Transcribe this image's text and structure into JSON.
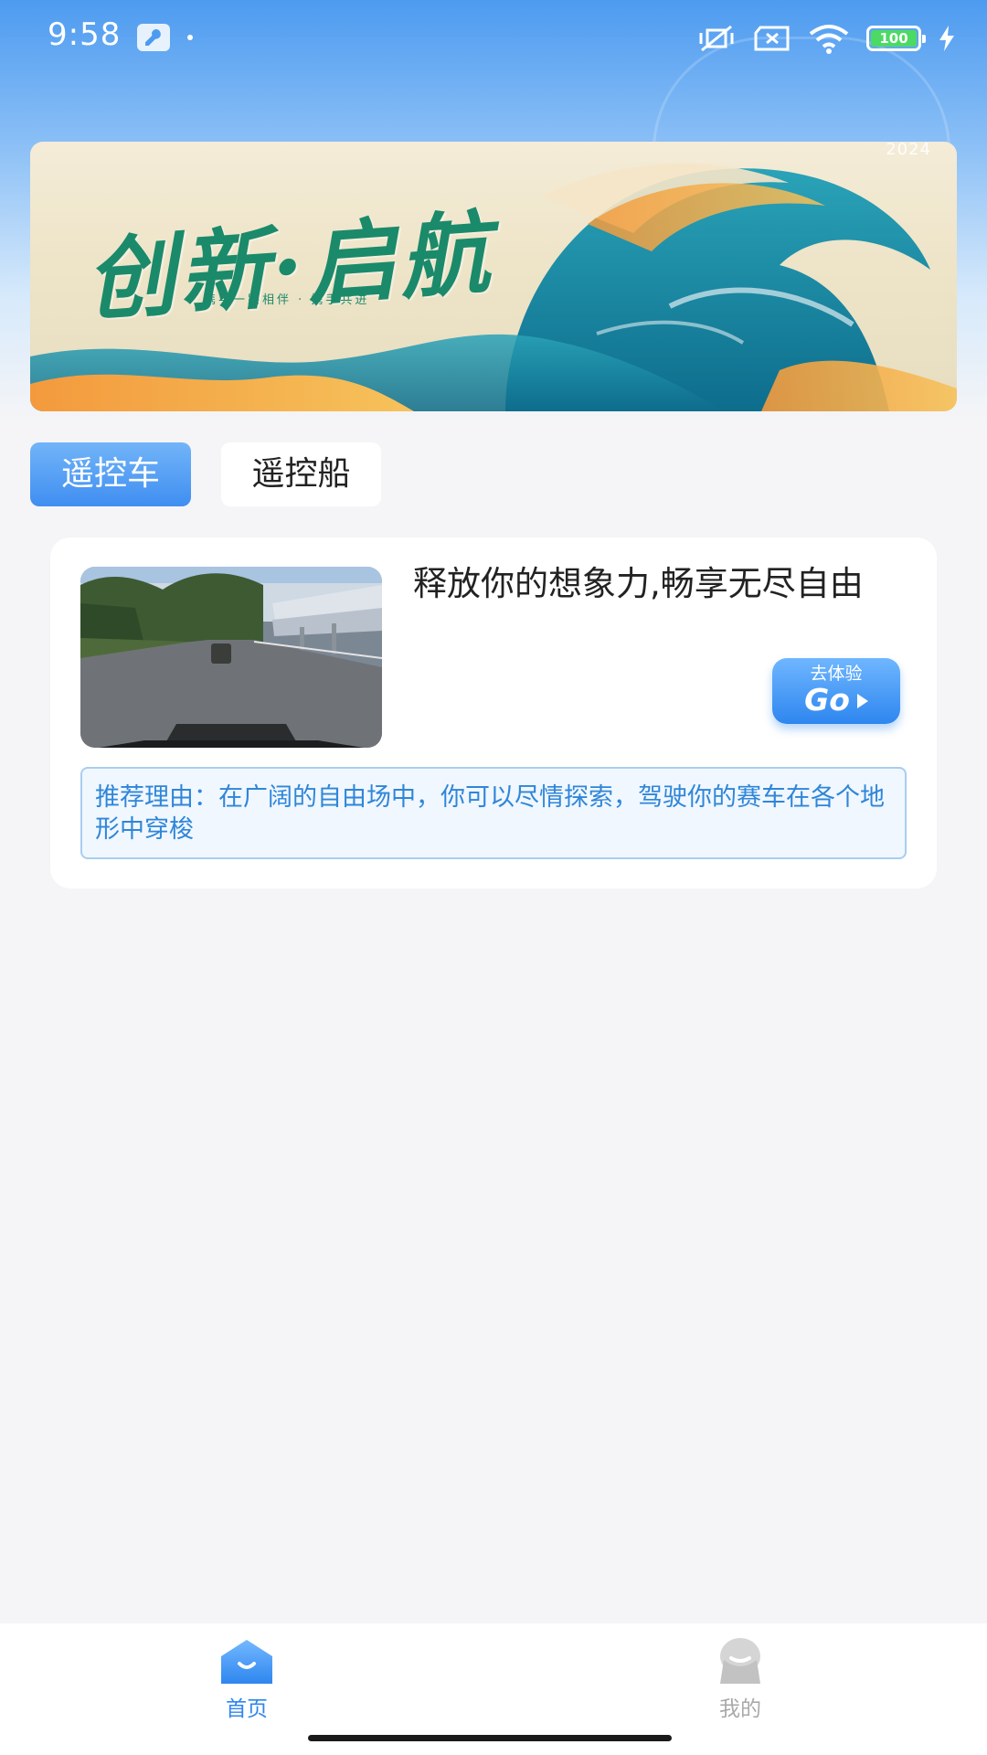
{
  "status_bar": {
    "time": "9:58",
    "battery": "100"
  },
  "banner": {
    "title": "创新·启航",
    "subtitle": "携手一路相伴 · 携手共进",
    "year": "2024"
  },
  "tabs": [
    {
      "label": "遥控车",
      "active": true
    },
    {
      "label": "遥控船",
      "active": false
    }
  ],
  "card": {
    "title": "释放你的想象力,畅享无尽自由",
    "go_button": {
      "label": "去体验",
      "text": "Go"
    },
    "reason": "推荐理由：在广阔的自由场中，你可以尽情探索，驾驶你的赛车在各个地形中穿梭"
  },
  "bottom_nav": [
    {
      "label": "首页",
      "icon": "home-icon",
      "active": true
    },
    {
      "label": "我的",
      "icon": "profile-icon",
      "active": false
    }
  ],
  "colors": {
    "accent": "#3f8ef1",
    "reason_text": "#2f86d8",
    "inactive_nav": "#a9a9a9"
  }
}
